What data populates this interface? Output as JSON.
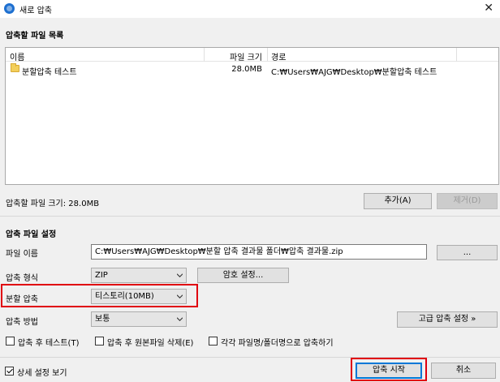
{
  "window": {
    "title": "새로 압축",
    "close_glyph": "✕"
  },
  "file_list": {
    "title": "압축할 파일 목록",
    "columns": {
      "name": "이름",
      "size": "파일 크기",
      "path": "경로"
    },
    "rows": [
      {
        "name": "분할압축 테스트",
        "size": "28.0MB",
        "path": "C:₩Users₩AJG₩Desktop₩분할압축 테스트"
      }
    ],
    "total_size": "압축할 파일 크기: 28.0MB",
    "add_button": "추가(A)",
    "remove_button": "제거(D)"
  },
  "settings": {
    "title": "압축 파일 설정",
    "filename_label": "파일 이름",
    "filename_value": "C:₩Users₩AJG₩Desktop₩분할 압축 결과물 폴더₩압축 결과물.zip",
    "browse_button": "...",
    "format_label": "압축 형식",
    "format_value": "ZIP",
    "password_button": "암호 설정...",
    "split_label": "분할 압축",
    "split_value": "티스토리(10MB)",
    "method_label": "압축 방법",
    "method_value": "보통",
    "advanced_button": "고급 압축 설정 »",
    "options": [
      {
        "label": "압축 후 테스트(T)",
        "checked": false
      },
      {
        "label": "압축 후 원본파일 삭제(E)",
        "checked": false
      },
      {
        "label": "각각 파일명/폴더명으로 압축하기",
        "checked": false
      }
    ]
  },
  "footer": {
    "details_label": "상세 설정 보기",
    "details_checked": true,
    "start_button": "압축 시작",
    "cancel_button": "취소"
  },
  "colors": {
    "highlight": "#e0000f",
    "accent": "#0078d7"
  }
}
